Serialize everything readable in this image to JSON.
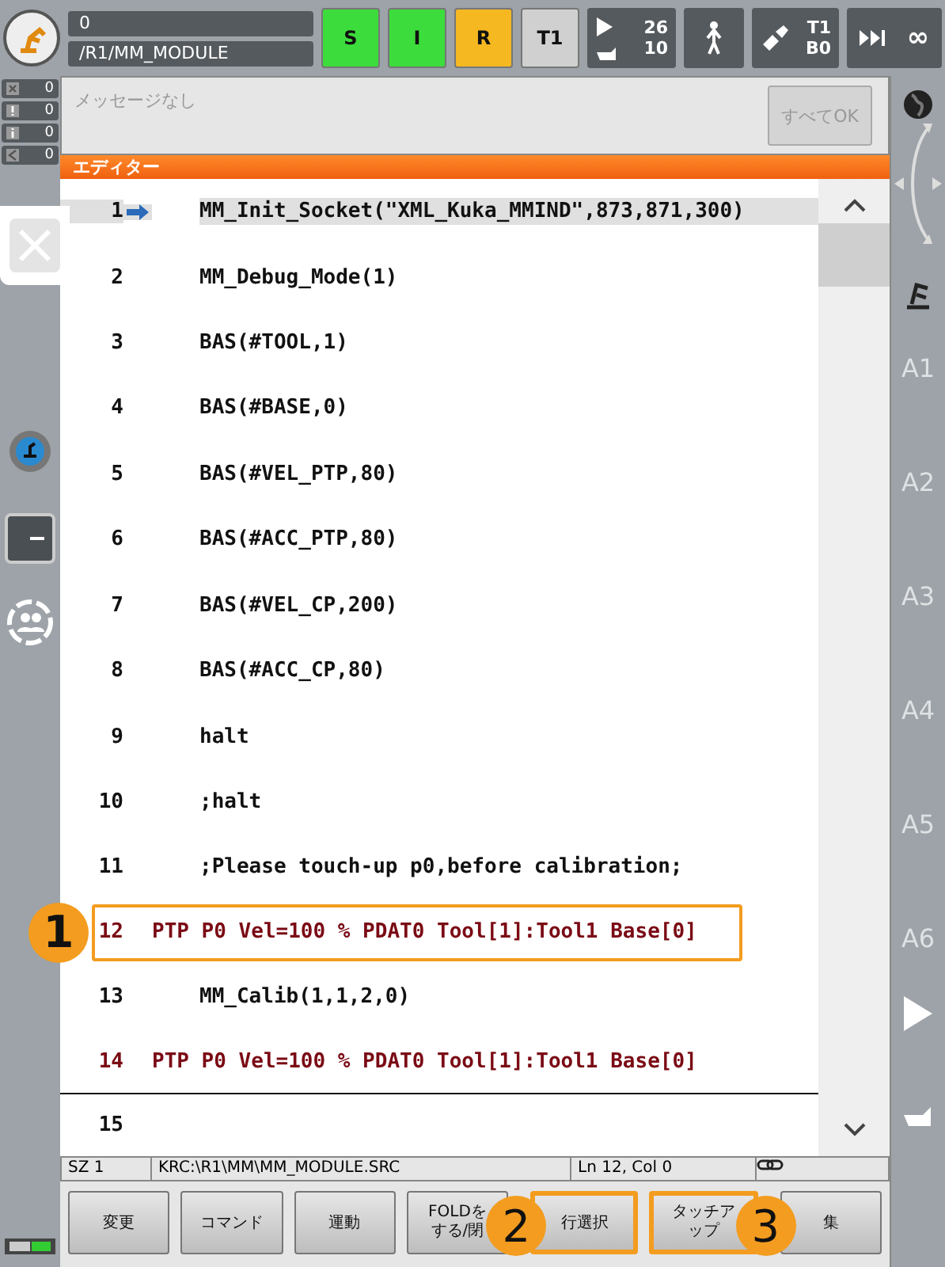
{
  "top_bar": {
    "field_1": "0",
    "path": "/R1/MM_MODULE",
    "states": [
      {
        "label": "S",
        "color": "#3cdc3c"
      },
      {
        "label": "I",
        "color": "#3cdc3c"
      },
      {
        "label": "R",
        "color": "#f5b820"
      },
      {
        "label": "T1",
        "color": "#d0d0d0"
      }
    ],
    "override": {
      "program": "26",
      "hand": "10"
    },
    "tool": {
      "tool": "T1",
      "base": "B0"
    },
    "speed": "∞"
  },
  "counters": [
    {
      "kind": "error",
      "value": "0"
    },
    {
      "kind": "warning",
      "value": "0"
    },
    {
      "kind": "info",
      "value": "0"
    },
    {
      "kind": "wait",
      "value": "0"
    }
  ],
  "message": {
    "text": "メッセージなし",
    "button": "すべてOK"
  },
  "editor": {
    "title": "エディター",
    "lines": [
      {
        "number": "1",
        "text": "MM_Init_Socket(\"XML_Kuka_MMIND\",873,871,300)",
        "kind": "code",
        "current": true,
        "marked": false
      },
      {
        "number": "2",
        "text": "MM_Debug_Mode(1)",
        "kind": "code",
        "current": false,
        "marked": false
      },
      {
        "number": "3",
        "text": "BAS(#TOOL,1)",
        "kind": "code",
        "current": false,
        "marked": false
      },
      {
        "number": "4",
        "text": "BAS(#BASE,0)",
        "kind": "code",
        "current": false,
        "marked": false
      },
      {
        "number": "5",
        "text": "BAS(#VEL_PTP,80)",
        "kind": "code",
        "current": false,
        "marked": false
      },
      {
        "number": "6",
        "text": "BAS(#ACC_PTP,80)",
        "kind": "code",
        "current": false,
        "marked": false
      },
      {
        "number": "7",
        "text": "BAS(#VEL_CP,200)",
        "kind": "code",
        "current": false,
        "marked": false
      },
      {
        "number": "8",
        "text": "BAS(#ACC_CP,80)",
        "kind": "code",
        "current": false,
        "marked": false
      },
      {
        "number": "9",
        "text": "halt",
        "kind": "code",
        "current": false,
        "marked": false
      },
      {
        "number": "10",
        "text": ";halt",
        "kind": "code",
        "current": false,
        "marked": false
      },
      {
        "number": "11",
        "text": ";Please touch-up p0,before calibration;",
        "kind": "code",
        "current": false,
        "marked": false
      },
      {
        "number": "12",
        "text": "PTP P0 Vel=100 % PDAT0 Tool[1]:Tool1 Base[0]",
        "kind": "motion",
        "current": false,
        "marked": true,
        "callout": "1"
      },
      {
        "number": "13",
        "text": "MM_Calib(1,1,2,0)",
        "kind": "code",
        "current": false,
        "marked": false
      },
      {
        "number": "14",
        "text": "PTP P0 Vel=100 % PDAT0 Tool[1]:Tool1 Base[0]",
        "kind": "motion",
        "current": false,
        "marked": false
      },
      {
        "number": "15",
        "kind": "fold_end",
        "current": false,
        "marked": false
      }
    ]
  },
  "status_bar": {
    "sz": "SZ 1",
    "file": "KRC:\\R1\\MM\\MM_MODULE.SRC",
    "position": "Ln 12, Col 0"
  },
  "buttons": [
    {
      "label": "変更",
      "marked": false
    },
    {
      "label": "コマンド",
      "marked": false
    },
    {
      "label": "運動",
      "marked": false
    },
    {
      "label": "FOLDをする/閉",
      "marked": false
    },
    {
      "label": "行選択",
      "marked": true,
      "callout": "2"
    },
    {
      "label": "タッチアップ",
      "marked": true
    },
    {
      "label": "集",
      "marked": false,
      "callout": "3"
    }
  ],
  "axes": [
    "A1",
    "A2",
    "A3",
    "A4",
    "A5",
    "A6"
  ]
}
